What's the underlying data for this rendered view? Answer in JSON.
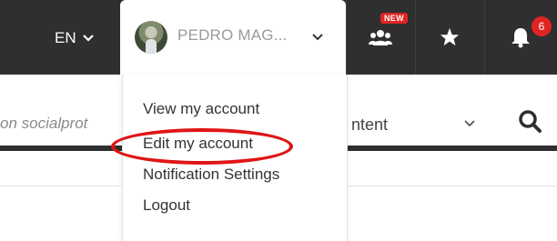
{
  "header": {
    "language": "EN",
    "user_name": "PEDRO MAG...",
    "groups_badge": "NEW",
    "notification_count": "6"
  },
  "search": {
    "placeholder_fragment": "on socialprot",
    "content_select_label": "ntent"
  },
  "account_menu": {
    "items": [
      {
        "label": "View my account"
      },
      {
        "label": "Edit my account",
        "highlighted": true
      },
      {
        "label": "Notification Settings"
      },
      {
        "label": "Logout"
      }
    ]
  },
  "colors": {
    "topbar": "#2f2f2f",
    "badge": "#e02424",
    "highlight_ring": "#e01515"
  },
  "icons": {
    "groups": "groups-icon",
    "favorites": "star-icon",
    "notifications": "bell-icon",
    "search": "search-icon"
  }
}
